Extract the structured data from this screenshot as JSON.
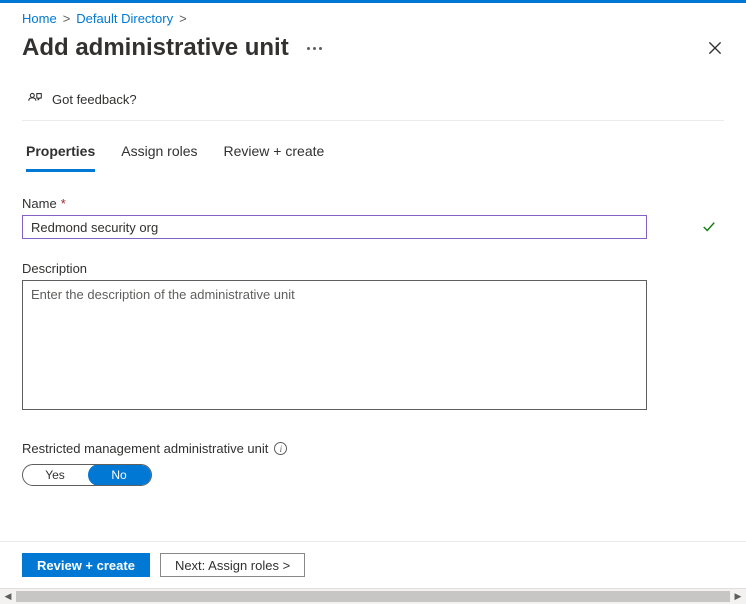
{
  "breadcrumb": {
    "items": [
      "Home",
      "Default Directory"
    ]
  },
  "header": {
    "title": "Add administrative unit"
  },
  "feedback": {
    "label": "Got feedback?"
  },
  "tabs": [
    {
      "label": "Properties",
      "active": true
    },
    {
      "label": "Assign roles",
      "active": false
    },
    {
      "label": "Review + create",
      "active": false
    }
  ],
  "form": {
    "name": {
      "label": "Name",
      "value": "Redmond security org",
      "valid": true
    },
    "description": {
      "label": "Description",
      "placeholder": "Enter the description of the administrative unit",
      "value": ""
    },
    "restricted": {
      "label": "Restricted management administrative unit",
      "options": {
        "yes": "Yes",
        "no": "No"
      },
      "value": "No"
    }
  },
  "footer": {
    "primary": "Review + create",
    "secondary": "Next: Assign roles >"
  },
  "colors": {
    "accent": "#0078d4",
    "focus_border": "#8661c5",
    "success": "#107c10"
  }
}
